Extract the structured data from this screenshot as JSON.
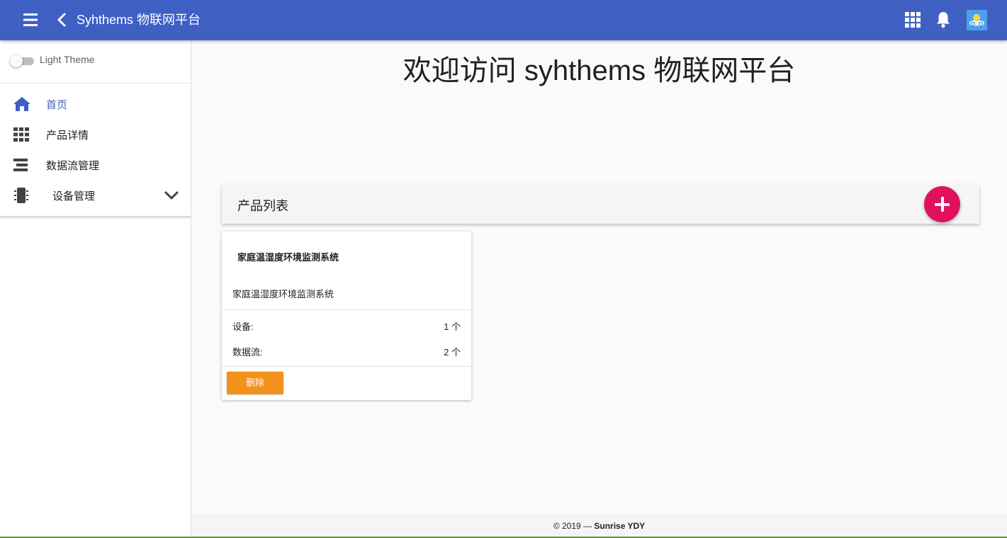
{
  "header": {
    "title": "Syhthems 物联网平台",
    "accent": "#3f5fc3"
  },
  "sidebar": {
    "theme_toggle_label": "Light Theme",
    "theme_toggle_on": false,
    "items": [
      {
        "label": "首页",
        "icon": "home-icon",
        "active": true
      },
      {
        "label": "产品详情",
        "icon": "grid-icon",
        "active": false
      },
      {
        "label": "数据流管理",
        "icon": "stream-icon",
        "active": false
      },
      {
        "label": "设备管理",
        "icon": "device-icon",
        "active": false,
        "expandable": true
      }
    ]
  },
  "main": {
    "welcome": "欢迎访问 syhthems 物联网平台",
    "list_title": "产品列表",
    "fab_color": "#e0115f",
    "products": [
      {
        "name": "家庭温湿度环境监测系统",
        "description": "家庭温湿度环境监测系统",
        "devices_label": "设备:",
        "devices_value": "1 个",
        "streams_label": "数据流:",
        "streams_value": "2 个",
        "delete_label": "删除"
      }
    ]
  },
  "footer": {
    "prefix": "© 2019 —",
    "author": "Sunrise YDY"
  }
}
